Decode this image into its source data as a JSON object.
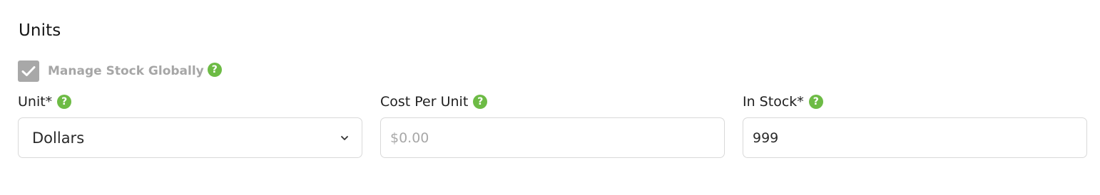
{
  "section": {
    "title": "Units"
  },
  "manage_stock": {
    "label": "Manage Stock Globally",
    "checked": true,
    "help": "?"
  },
  "fields": {
    "unit": {
      "label": "Unit*",
      "selected": "Dollars",
      "help": "?"
    },
    "cost_per_unit": {
      "label": "Cost Per Unit",
      "value": "",
      "placeholder": "$0.00",
      "help": "?"
    },
    "in_stock": {
      "label": "In Stock*",
      "value": "999",
      "help": "?"
    }
  },
  "colors": {
    "help_icon": "#6dbb45",
    "checkbox_disabled": "#a8a8a8",
    "border": "#d9d9d9",
    "placeholder": "#a8a8a8"
  },
  "icons": {
    "checkbox_mark": "check-icon",
    "help": "question-circle-icon",
    "select_caret": "chevron-down-icon"
  }
}
